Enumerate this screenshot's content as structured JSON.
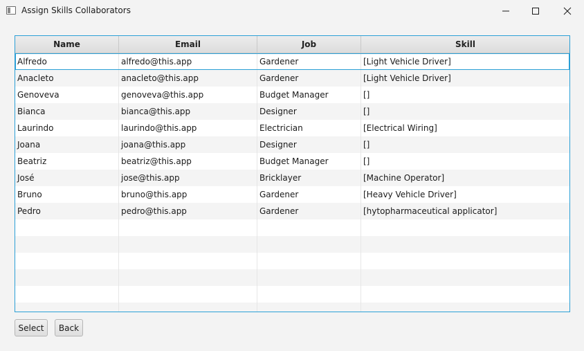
{
  "window": {
    "title": "Assign Skills Collaborators",
    "icons": {
      "app": "app-window-icon",
      "minimize": "minimize-icon",
      "maximize": "maximize-icon",
      "close": "close-icon"
    }
  },
  "table": {
    "columns": [
      "Name",
      "Email",
      "Job",
      "Skill"
    ],
    "rows": [
      [
        "Alfredo",
        "alfredo@this.app",
        "Gardener",
        "[Light Vehicle Driver]"
      ],
      [
        "Anacleto",
        "anacleto@this.app",
        "Gardener",
        "[Light Vehicle Driver]"
      ],
      [
        "Genoveva",
        "genoveva@this.app",
        "Budget Manager",
        "[]"
      ],
      [
        "Bianca",
        "bianca@this.app",
        "Designer",
        "[]"
      ],
      [
        "Laurindo",
        "laurindo@this.app",
        "Electrician",
        "[Electrical Wiring]"
      ],
      [
        "Joana",
        "joana@this.app",
        "Designer",
        "[]"
      ],
      [
        "Beatriz",
        "beatriz@this.app",
        "Budget Manager",
        "[]"
      ],
      [
        "José",
        "jose@this.app",
        "Bricklayer",
        "[Machine Operator]"
      ],
      [
        "Bruno",
        "bruno@this.app",
        "Gardener",
        "[Heavy Vehicle Driver]"
      ],
      [
        "Pedro",
        "pedro@this.app",
        "Gardener",
        "[hytopharmaceutical applicator]"
      ]
    ],
    "selected_row": 0
  },
  "buttons": {
    "select_label": "Select",
    "back_label": "Back"
  },
  "colors": {
    "focus_border": "#2a9fd6",
    "row_alt": "#f4f4f4"
  }
}
